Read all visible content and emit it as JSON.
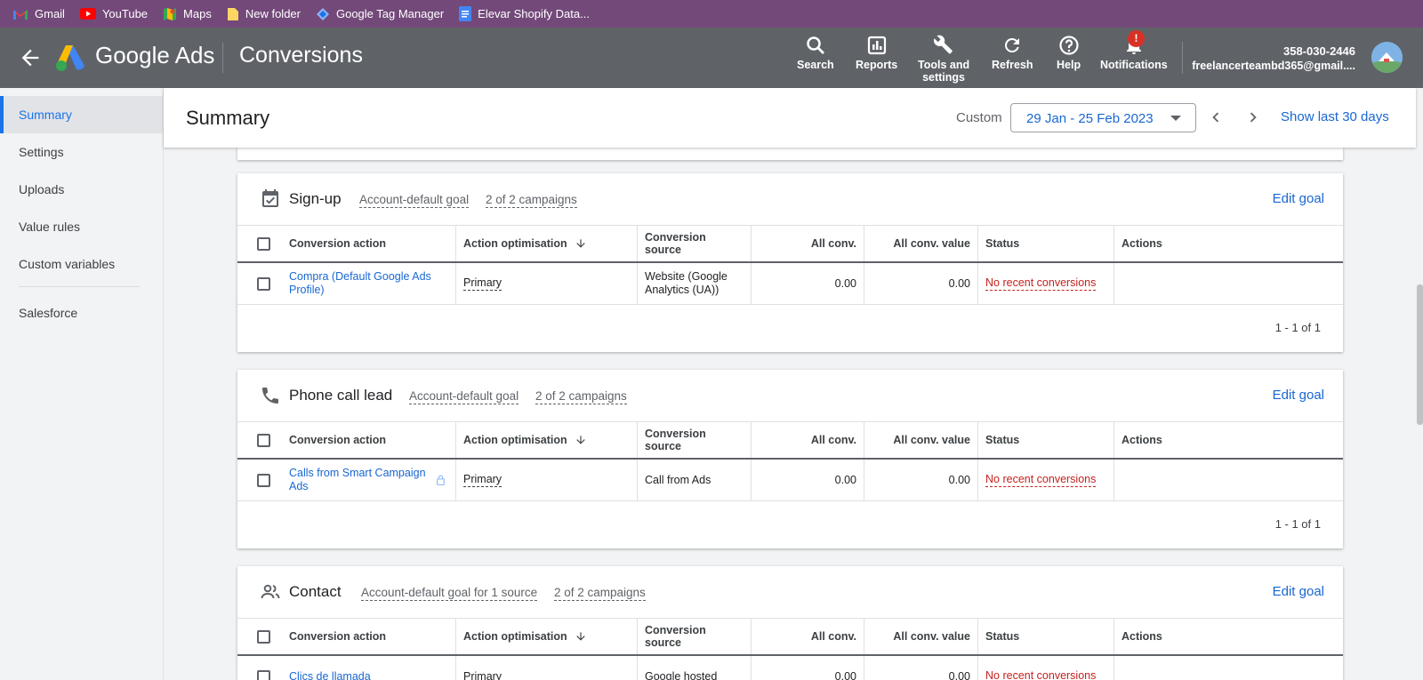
{
  "bookmarks": [
    {
      "label": "Gmail",
      "icon": "gmail-icon"
    },
    {
      "label": "YouTube",
      "icon": "youtube-icon"
    },
    {
      "label": "Maps",
      "icon": "maps-icon"
    },
    {
      "label": "New folder",
      "icon": "folder-icon"
    },
    {
      "label": "Google Tag Manager",
      "icon": "tag-manager-icon"
    },
    {
      "label": "Elevar Shopify Data...",
      "icon": "docs-icon"
    }
  ],
  "header": {
    "brand": "Google Ads",
    "page": "Conversions",
    "tools": {
      "search": "Search",
      "reports": "Reports",
      "tools_line1": "Tools and",
      "tools_line2": "settings",
      "refresh": "Refresh",
      "help": "Help",
      "notifications": "Notifications",
      "notif_badge": "!"
    },
    "account_id": "358-030-2446",
    "account_email": "freelancerteambd365@gmail...."
  },
  "sidebar": {
    "items": [
      "Summary",
      "Settings",
      "Uploads",
      "Value rules",
      "Custom variables",
      "Salesforce"
    ]
  },
  "summary": {
    "title": "Summary",
    "custom_label": "Custom",
    "date_range": "29 Jan - 25 Feb 2023",
    "show_last": "Show last 30 days"
  },
  "table_headers": {
    "conversion_action": "Conversion action",
    "action_optimisation": "Action optimisation",
    "conversion_source": "Conversion source",
    "all_conv": "All conv.",
    "all_conv_value": "All conv. value",
    "status": "Status",
    "actions": "Actions"
  },
  "goals": [
    {
      "title": "Sign-up",
      "icon": "checkbox-icon",
      "tag1": "Account-default goal",
      "tag2": "2 of 2 campaigns",
      "edit": "Edit goal",
      "row": {
        "action_line1": "Compra (Default Google Ads",
        "action_line2": "Profile)",
        "optimisation": "Primary",
        "source_line1": "Website (Google",
        "source_line2": "Analytics (UA))",
        "all_conv": "0.00",
        "all_conv_value": "0.00",
        "status": "No recent conversions"
      },
      "pager": "1 - 1 of 1"
    },
    {
      "title": "Phone call lead",
      "icon": "phone-icon",
      "tag1": "Account-default goal",
      "tag2": "2 of 2 campaigns",
      "edit": "Edit goal",
      "row": {
        "action_line1": "Calls from Smart Campaign",
        "action_line2": "Ads",
        "optimisation": "Primary",
        "source_line1": "Call from Ads",
        "source_line2": "",
        "all_conv": "0.00",
        "all_conv_value": "0.00",
        "status": "No recent conversions"
      },
      "pager": "1 - 1 of 1"
    },
    {
      "title": "Contact",
      "icon": "people-icon",
      "tag1": "Account-default goal for 1 source",
      "tag2": "2 of 2 campaigns",
      "edit": "Edit goal",
      "row": {
        "action_line1": "Clics de llamada",
        "action_line2": "",
        "optimisation": "Primary",
        "source_line1": "Google hosted",
        "source_line2": "",
        "all_conv": "0.00",
        "all_conv_value": "0.00",
        "status": "No recent conversions"
      }
    }
  ]
}
